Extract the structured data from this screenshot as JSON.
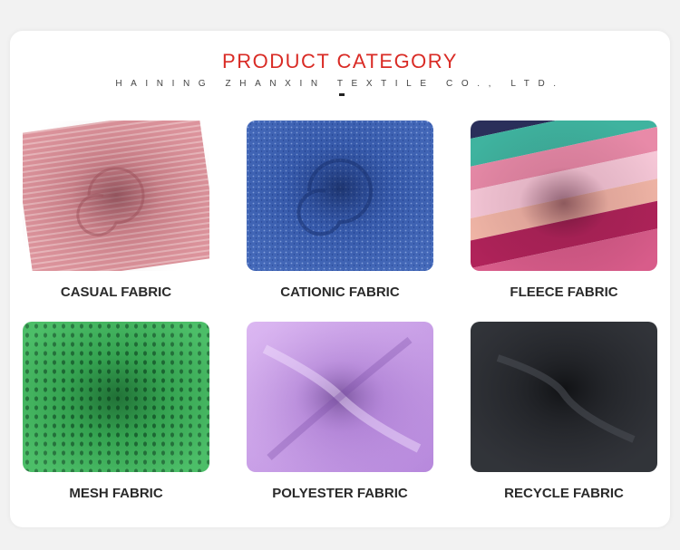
{
  "header": {
    "title": "PRODUCT CATEGORY",
    "subtitle": "HAINING ZHANXIN TEXTILE CO., LTD.",
    "accent_color": "#d92b25"
  },
  "products": [
    {
      "label": "CASUAL FABRIC",
      "color": "#d4878f"
    },
    {
      "label": "CATIONIC FABRIC",
      "color": "#3d62b4"
    },
    {
      "label": "FLEECE FABRIC",
      "color": "#e8a7b5"
    },
    {
      "label": "MESH FABRIC",
      "color": "#3cb55a"
    },
    {
      "label": "POLYESTER FABRIC",
      "color": "#c18ee0"
    },
    {
      "label": "RECYCLE FABRIC",
      "color": "#2a2c31"
    }
  ]
}
